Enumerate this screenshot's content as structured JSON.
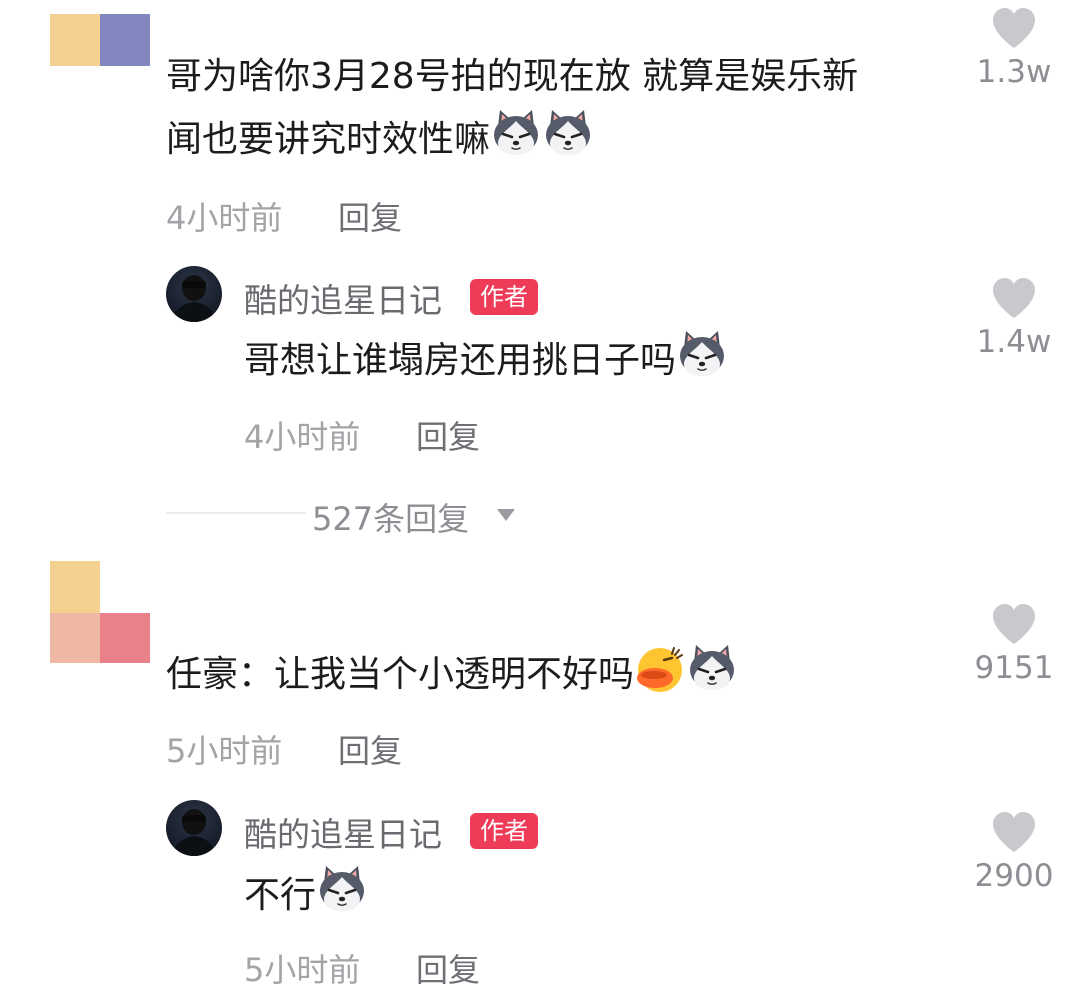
{
  "comments": [
    {
      "text_line1": "哥为啥你3月28号拍的现在放 就算是娱乐新",
      "text_line2": "闻也要讲究时效性嘛",
      "time": "4小时前",
      "reply_label": "回复",
      "likes": "1.3w",
      "emojis": [
        "husky-emoji",
        "husky-emoji"
      ],
      "reply": {
        "author": "酷的追星日记",
        "badge": "作者",
        "text": "哥想让谁塌房还用挑日子吗",
        "emojis": [
          "husky-emoji"
        ],
        "time": "4小时前",
        "reply_label": "回复",
        "likes": "1.4w"
      },
      "expand_replies": "527条回复"
    },
    {
      "text": "任豪：让我当个小透明不好吗",
      "time": "5小时前",
      "reply_label": "回复",
      "likes": "9151",
      "emojis": [
        "quack-emoji",
        "husky-emoji"
      ],
      "reply": {
        "author": "酷的追星日记",
        "badge": "作者",
        "text": "不行",
        "emojis": [
          "husky-emoji"
        ],
        "time": "5小时前",
        "reply_label": "回复",
        "likes": "2900"
      }
    }
  ],
  "colors": {
    "badge_bg": "#ee3b57",
    "heart": "#c9c9cd",
    "meta": "#a3a3a8"
  }
}
